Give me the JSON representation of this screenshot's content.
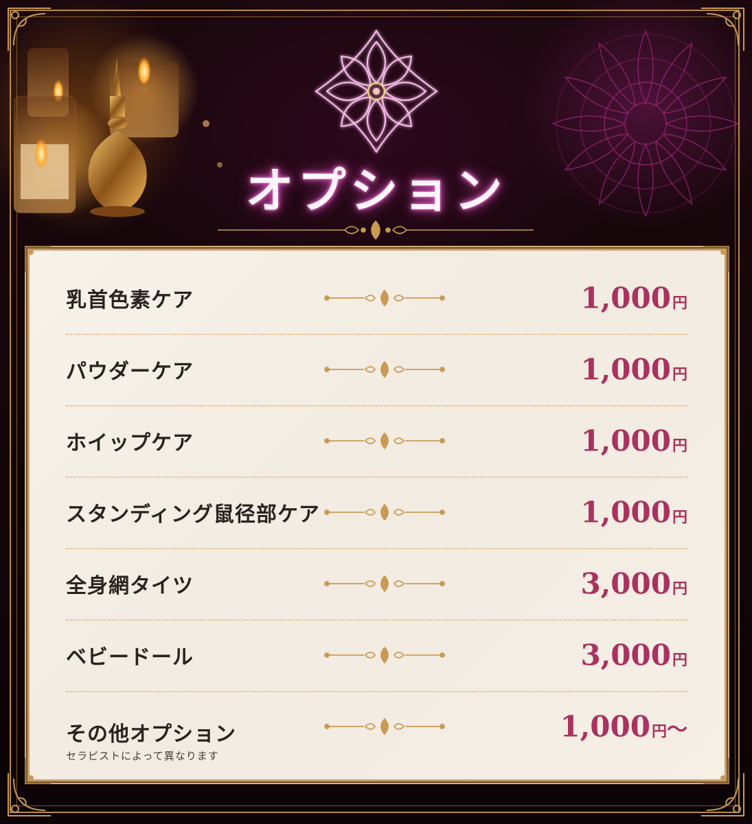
{
  "title": "オプション",
  "colors": {
    "gold": "#c9a06a",
    "price": "#a9325f",
    "glow": "#e05cc0",
    "panel": "#f5efe6"
  },
  "icons": [
    "lotus-emblem-icon",
    "candle-icon",
    "perfume-bottle-icon",
    "mandala-icon",
    "flourish-divider-icon",
    "corner-ornament-icon"
  ],
  "options": [
    {
      "name": "乳首色素ケア",
      "price": "1,000",
      "unit": "円",
      "suffix": "",
      "note": ""
    },
    {
      "name": "パウダーケア",
      "price": "1,000",
      "unit": "円",
      "suffix": "",
      "note": ""
    },
    {
      "name": "ホイップケア",
      "price": "1,000",
      "unit": "円",
      "suffix": "",
      "note": ""
    },
    {
      "name": "スタンディング鼠径部ケア",
      "price": "1,000",
      "unit": "円",
      "suffix": "",
      "note": ""
    },
    {
      "name": "全身網タイツ",
      "price": "3,000",
      "unit": "円",
      "suffix": "",
      "note": ""
    },
    {
      "name": "ベビードール",
      "price": "3,000",
      "unit": "円",
      "suffix": "",
      "note": ""
    },
    {
      "name": "その他オプション",
      "price": "1,000",
      "unit": "円",
      "suffix": "〜",
      "note": "セラピストによって異なります"
    }
  ]
}
